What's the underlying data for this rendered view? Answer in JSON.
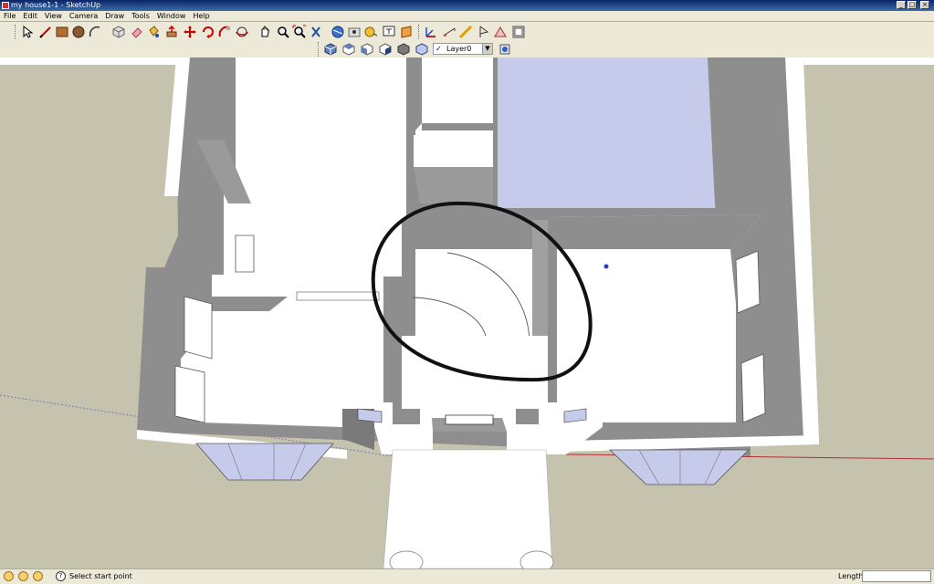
{
  "window": {
    "title": "my house1-1 - SketchUp"
  },
  "menu": [
    {
      "id": "file",
      "label": "File"
    },
    {
      "id": "edit",
      "label": "Edit"
    },
    {
      "id": "view",
      "label": "View"
    },
    {
      "id": "camera",
      "label": "Camera"
    },
    {
      "id": "draw",
      "label": "Draw"
    },
    {
      "id": "tools",
      "label": "Tools"
    },
    {
      "id": "window",
      "label": "Window"
    },
    {
      "id": "help",
      "label": "Help"
    }
  ],
  "toolbar": {
    "tools": [
      "select",
      "line",
      "rectangle",
      "circle",
      "arc",
      "make-component",
      "eraser",
      "paint-bucket",
      "push-pull",
      "move",
      "rotate",
      "follow-me",
      "orbit",
      "pan",
      "zoom",
      "zoom-extents",
      "walk",
      "position-camera",
      "look-around",
      "tape-measure",
      "text",
      "section-plane",
      "axes"
    ],
    "views": [
      "iso",
      "top",
      "front",
      "right",
      "back",
      "left"
    ],
    "layer": {
      "label": "Layer0"
    }
  },
  "status": {
    "text": "Select start point",
    "length_label": "Length",
    "length_value": ""
  },
  "colors": {
    "ground": "#c5c2ad",
    "sky": "#ffffff",
    "wall_top": "#ffffff",
    "wall_face": "#8e8e8e",
    "glass": "#c7cbeb",
    "annotation": "#111111"
  }
}
